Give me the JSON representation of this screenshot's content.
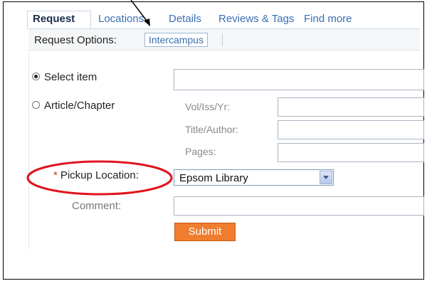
{
  "tabs": [
    {
      "label": "Request",
      "active": true
    },
    {
      "label": "Locations",
      "active": false
    },
    {
      "label": "Details",
      "active": false
    },
    {
      "label": "Reviews & Tags",
      "active": false
    },
    {
      "label": "Find more",
      "active": false
    }
  ],
  "request_options": {
    "label": "Request Options:",
    "button_label": "Intercampus"
  },
  "form": {
    "select_item_label": "Select item",
    "article_chapter_label": "Article/Chapter",
    "vol_iss_yr_label": "Vol/Iss/Yr:",
    "title_author_label": "Title/Author:",
    "pages_label": "Pages:",
    "pickup_location_label": "Pickup Location:",
    "required_marker": "*",
    "pickup_location_value": "Epsom Library",
    "comment_label": "Comment:",
    "submit_label": "Submit",
    "selected_radio": "select_item"
  },
  "colors": {
    "active_tab": "#1c2d4a",
    "tab_link": "#3a6fb0",
    "submit_button": "#f07c2e",
    "required_marker": "#c43b1d",
    "annotation_circle": "#e0141e",
    "annotation_arrow": "#000000"
  },
  "icons": {
    "dropdown": "chevron-down-icon",
    "annotation_arrow": "arrow-icon"
  }
}
